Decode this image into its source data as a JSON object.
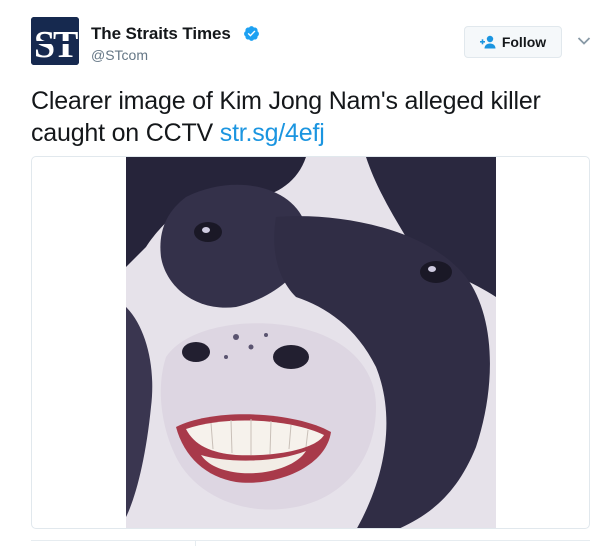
{
  "tweet": {
    "author": {
      "display_name": "The Straits Times",
      "screen_name": "@STcom",
      "verified": true,
      "avatar_letters": "ST",
      "avatar_bg": "#16294f"
    },
    "follow_button": {
      "label": "Follow",
      "icon": "add-person-icon"
    },
    "menu_icon": "chevron-down-icon",
    "text": "Clearer image of Kim Jong Nam's alleged killer caught on CCTV",
    "link": "str.sg/4efj",
    "media": {
      "type": "photo",
      "subject": "smiling-cow"
    },
    "colors": {
      "link": "#1b95e0",
      "verified": "#1da1f2",
      "text": "#14171a",
      "muted": "#657786"
    }
  }
}
